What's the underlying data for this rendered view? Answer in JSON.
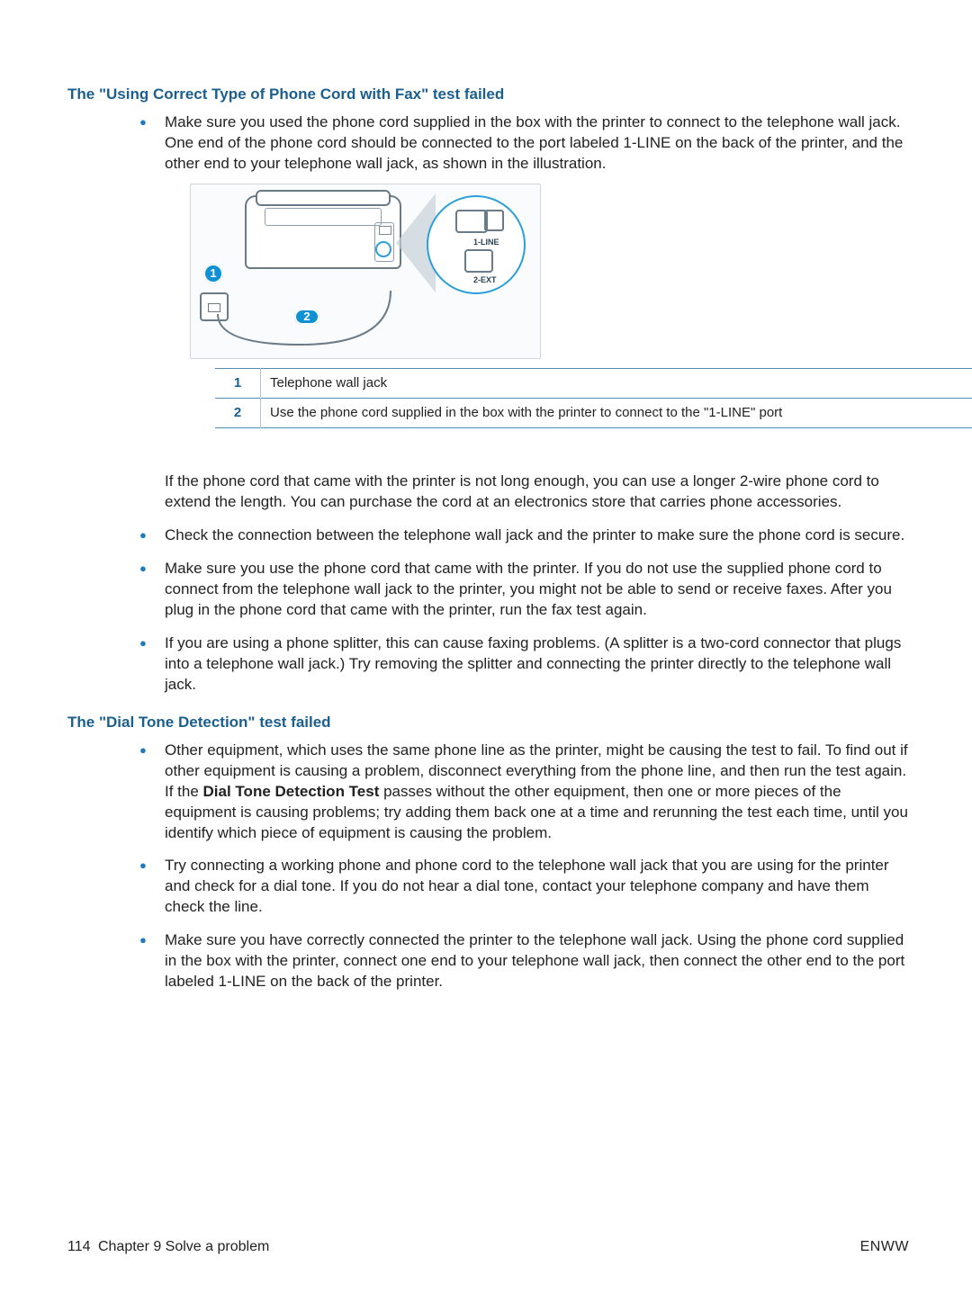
{
  "section1": {
    "heading": "The \"Using Correct Type of Phone Cord with Fax\" test failed",
    "bullet1": "Make sure you used the phone cord supplied in the box with the printer to connect to the telephone wall jack. One end of the phone cord should be connected to the port labeled 1-LINE on the back of the printer, and the other end to your telephone wall jack, as shown in the illustration.",
    "zoom_label_line": "1-LINE",
    "zoom_label_ext": "2-EXT",
    "legend": {
      "row1_num": "1",
      "row1_text": "Telephone wall jack",
      "row2_num": "2",
      "row2_text": "Use the phone cord supplied in the box with the printer to connect to the \"1-LINE\" port"
    },
    "para_after": "If the phone cord that came with the printer is not long enough, you can use a longer 2-wire phone cord to extend the length. You can purchase the cord at an electronics store that carries phone accessories.",
    "bullet2": "Check the connection between the telephone wall jack and the printer to make sure the phone cord is secure.",
    "bullet3": "Make sure you use the phone cord that came with the printer. If you do not use the supplied phone cord to connect from the telephone wall jack to the printer, you might not be able to send or receive faxes. After you plug in the phone cord that came with the printer, run the fax test again.",
    "bullet4": "If you are using a phone splitter, this can cause faxing problems. (A splitter is a two-cord connector that plugs into a telephone wall jack.) Try removing the splitter and connecting the printer directly to the telephone wall jack."
  },
  "section2": {
    "heading": "The \"Dial Tone Detection\" test failed",
    "bullet1_pre": "Other equipment, which uses the same phone line as the printer, might be causing the test to fail. To find out if other equipment is causing a problem, disconnect everything from the phone line, and then run the test again. If the ",
    "bullet1_bold": "Dial Tone Detection Test",
    "bullet1_post": " passes without the other equipment, then one or more pieces of the equipment is causing problems; try adding them back one at a time and rerunning the test each time, until you identify which piece of equipment is causing the problem.",
    "bullet2": "Try connecting a working phone and phone cord to the telephone wall jack that you are using for the printer and check for a dial tone. If you do not hear a dial tone, contact your telephone company and have them check the line.",
    "bullet3": "Make sure you have correctly connected the printer to the telephone wall jack. Using the phone cord supplied in the box with the printer, connect one end to your telephone wall jack, then connect the other end to the port labeled 1-LINE on the back of the printer."
  },
  "footer": {
    "page_number": "114",
    "chapter": "Chapter 9   Solve a problem",
    "marker": "ENWW"
  }
}
